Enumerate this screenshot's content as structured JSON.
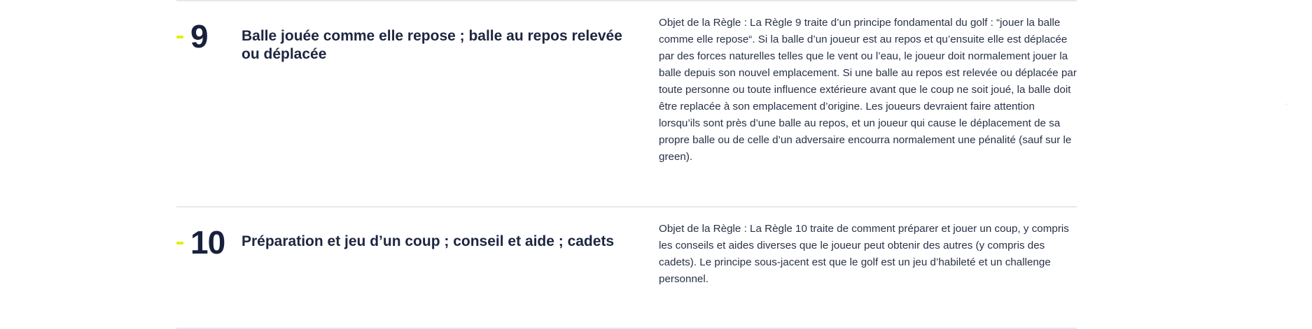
{
  "rules": [
    {
      "number": "9",
      "title": "Balle jouée comme elle repose ; balle au repos relevée ou déplacée",
      "description": "Objet de la Règle : La Règle 9 traite d’un principe fondamental du golf : “jouer la balle comme elle repose“. Si la balle d’un joueur est au repos et qu’ensuite elle est déplacée par des forces naturelles telles que le vent ou l’eau, le joueur doit normalement jouer la balle depuis son nouvel emplacement. Si une balle au repos est relevée ou déplacée par toute personne ou toute influence extérieure avant que le coup ne soit joué, la balle doit être replacée à son emplacement d’origine. Les joueurs devraient faire attention lorsqu’ils sont près d’une balle au repos, et un joueur qui cause le déplacement de sa propre balle ou de celle d’un adversaire encourra normalement une pénalité (sauf sur le green)."
    },
    {
      "number": "10",
      "title": "Préparation et jeu d’un coup ; conseil et aide ; cadets",
      "description": "Objet de la Règle : La Règle 10 traite de comment préparer et jouer un coup, y compris les conseils et aides diverses que le joueur peut obtenir des autres (y compris des cadets). Le principe sous-jacent est que le golf est un jeu d’habileté et un challenge personnel."
    }
  ],
  "colors": {
    "accent": "#e2f000",
    "text": "#1d2640",
    "divider": "#e6e8ee"
  }
}
